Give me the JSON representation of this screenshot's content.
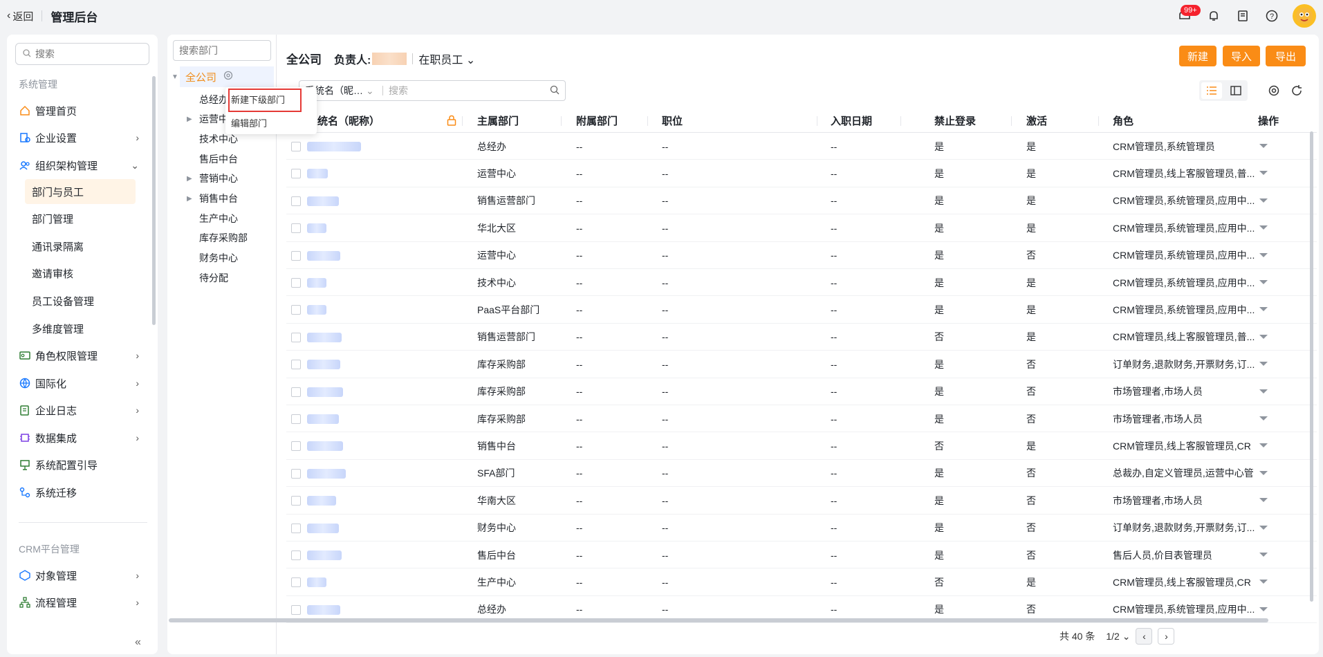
{
  "topbar": {
    "back_label": "返回",
    "title": "管理后台",
    "notification_badge": "99+",
    "icons": [
      "inbox-icon",
      "bell-icon",
      "book-icon",
      "help-icon",
      "avatar"
    ]
  },
  "sidebar": {
    "search_placeholder": "搜索",
    "group1_title": "系统管理",
    "items": [
      {
        "label": "管理首页",
        "icon": "home-icon"
      },
      {
        "label": "企业设置",
        "icon": "enterprise-icon"
      },
      {
        "label": "组织架构管理",
        "icon": "org-icon"
      },
      {
        "label": "角色权限管理",
        "icon": "role-icon"
      },
      {
        "label": "国际化",
        "icon": "globe-icon"
      },
      {
        "label": "企业日志",
        "icon": "log-icon"
      },
      {
        "label": "数据集成",
        "icon": "chip-icon"
      },
      {
        "label": "系统配置引导",
        "icon": "guide-icon"
      },
      {
        "label": "系统迁移",
        "icon": "migrate-icon"
      }
    ],
    "sub_items": [
      "部门与员工",
      "部门管理",
      "通讯录隔离",
      "邀请审核",
      "员工设备管理",
      "多维度管理"
    ],
    "group2_title": "CRM平台管理",
    "items2": [
      {
        "label": "对象管理",
        "icon": "object-icon"
      },
      {
        "label": "流程管理",
        "icon": "flow-icon"
      }
    ]
  },
  "tree": {
    "search_placeholder": "搜索部门",
    "root": "全公司",
    "nodes": [
      "总经办",
      "运营中",
      "技术中心",
      "售后中台",
      "营销中心",
      "销售中台",
      "生产中心",
      "库存采购部",
      "财务中心",
      "待分配"
    ]
  },
  "context_menu": {
    "items": [
      "新建下级部门",
      "编辑部门"
    ]
  },
  "header": {
    "dept": "全公司",
    "owner_label": "负责人:",
    "status_filter": "在职员工"
  },
  "buttons": {
    "new": "新建",
    "import": "导入",
    "export": "导出"
  },
  "search": {
    "field": "系统名（昵…",
    "placeholder": "搜索"
  },
  "table": {
    "columns": [
      "系统名（昵称）",
      "主属部门",
      "附属部门",
      "职位",
      "入职日期",
      "禁止登录",
      "激活",
      "角色",
      "操作"
    ],
    "rows": [
      {
        "dept": "总经办",
        "sub": "--",
        "pos": "--",
        "date": "--",
        "ban": "是",
        "active": "是",
        "role": "CRM管理员,系统管理员"
      },
      {
        "dept": "运营中心",
        "sub": "--",
        "pos": "--",
        "date": "--",
        "ban": "是",
        "active": "是",
        "role": "CRM管理员,线上客服管理员,普..."
      },
      {
        "dept": "销售运营部门",
        "sub": "--",
        "pos": "--",
        "date": "--",
        "ban": "是",
        "active": "是",
        "role": "CRM管理员,系统管理员,应用中..."
      },
      {
        "dept": "华北大区",
        "sub": "--",
        "pos": "--",
        "date": "--",
        "ban": "是",
        "active": "是",
        "role": "CRM管理员,系统管理员,应用中..."
      },
      {
        "dept": "运营中心",
        "sub": "--",
        "pos": "--",
        "date": "--",
        "ban": "是",
        "active": "否",
        "role": "CRM管理员,系统管理员,应用中..."
      },
      {
        "dept": "技术中心",
        "sub": "--",
        "pos": "--",
        "date": "--",
        "ban": "是",
        "active": "是",
        "role": "CRM管理员,系统管理员,应用中..."
      },
      {
        "dept": "PaaS平台部门",
        "sub": "--",
        "pos": "--",
        "date": "--",
        "ban": "是",
        "active": "是",
        "role": "CRM管理员,系统管理员,应用中..."
      },
      {
        "dept": "销售运营部门",
        "sub": "--",
        "pos": "--",
        "date": "--",
        "ban": "否",
        "active": "是",
        "role": "CRM管理员,线上客服管理员,普..."
      },
      {
        "dept": "库存采购部",
        "sub": "--",
        "pos": "--",
        "date": "--",
        "ban": "是",
        "active": "否",
        "role": "订单财务,退款财务,开票财务,订..."
      },
      {
        "dept": "库存采购部",
        "sub": "--",
        "pos": "--",
        "date": "--",
        "ban": "是",
        "active": "否",
        "role": "市场管理者,市场人员"
      },
      {
        "dept": "库存采购部",
        "sub": "--",
        "pos": "--",
        "date": "--",
        "ban": "是",
        "active": "否",
        "role": "市场管理者,市场人员"
      },
      {
        "dept": "销售中台",
        "sub": "--",
        "pos": "--",
        "date": "--",
        "ban": "否",
        "active": "是",
        "role": "CRM管理员,线上客服管理员,CR"
      },
      {
        "dept": "SFA部门",
        "sub": "--",
        "pos": "--",
        "date": "--",
        "ban": "是",
        "active": "否",
        "role": "总裁办,自定义管理员,运营中心管"
      },
      {
        "dept": "华南大区",
        "sub": "--",
        "pos": "--",
        "date": "--",
        "ban": "是",
        "active": "否",
        "role": "市场管理者,市场人员"
      },
      {
        "dept": "财务中心",
        "sub": "--",
        "pos": "--",
        "date": "--",
        "ban": "是",
        "active": "否",
        "role": "订单财务,退款财务,开票财务,订..."
      },
      {
        "dept": "售后中台",
        "sub": "--",
        "pos": "--",
        "date": "--",
        "ban": "是",
        "active": "否",
        "role": "售后人员,价目表管理员"
      },
      {
        "dept": "生产中心",
        "sub": "--",
        "pos": "--",
        "date": "--",
        "ban": "否",
        "active": "是",
        "role": "CRM管理员,线上客服管理员,CR"
      },
      {
        "dept": "总经办",
        "sub": "--",
        "pos": "--",
        "date": "--",
        "ban": "是",
        "active": "否",
        "role": "CRM管理员,系统管理员,应用中..."
      }
    ]
  },
  "pager": {
    "total": "共 40 条",
    "page": "1/2"
  },
  "colors": {
    "accent": "#fa8c16",
    "tree_active": "#f08d1b",
    "highlight_box": "#e53935"
  }
}
